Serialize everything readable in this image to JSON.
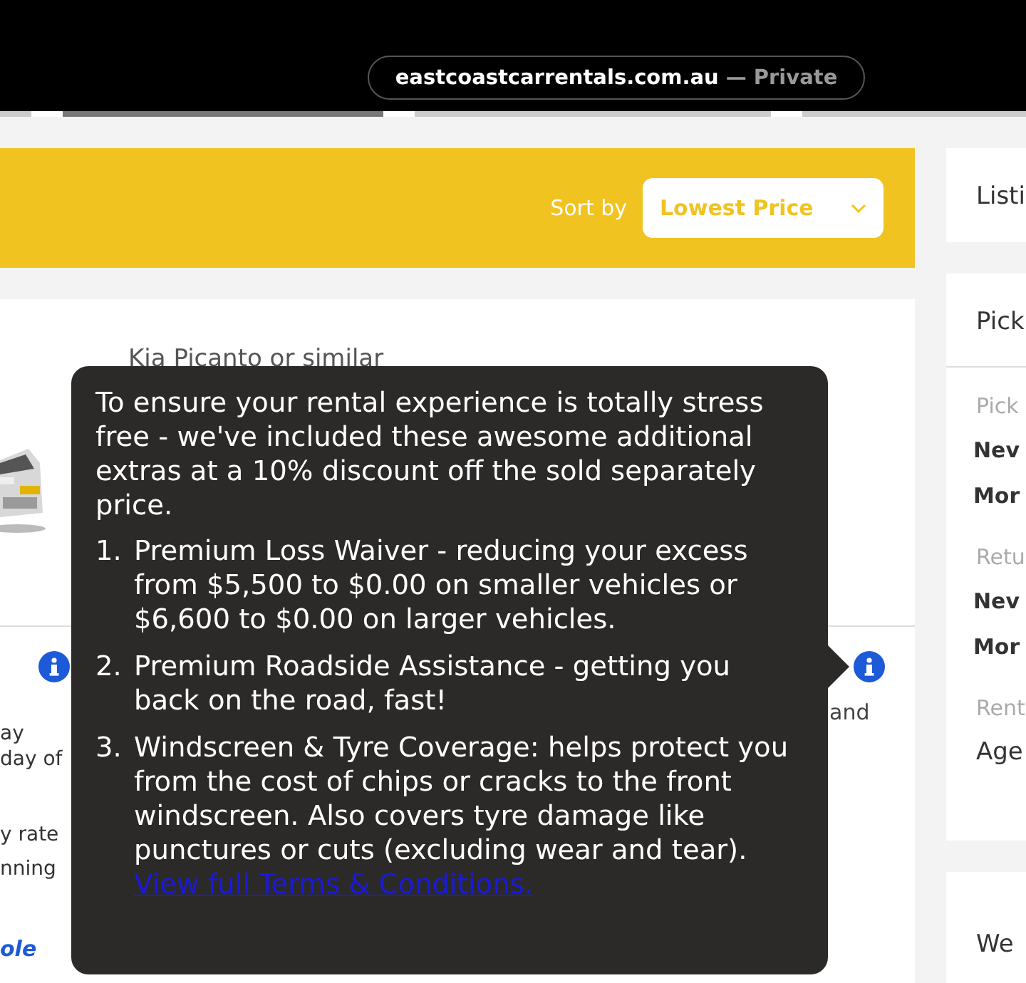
{
  "browser": {
    "url": "eastcoastcarrentals.com.au",
    "mode": "— Private"
  },
  "toolbar": {
    "sort_label": "Sort by",
    "sort_value": "Lowest Price"
  },
  "listing": {
    "vehicle": "Kia Picanto or similar",
    "fragments": [
      "ay",
      "day of",
      "y rate",
      "nning"
    ],
    "link": "ole",
    "right_text": "and"
  },
  "tooltip": {
    "intro": "To ensure your rental experience is totally stress free - we've included these awesome additional extras at a 10% discount off the sold separately price.",
    "items": [
      {
        "number": "1.",
        "text": "Premium Loss Waiver - reducing your excess from $5,500 to $0.00 on smaller vehicles or $6,600 to $0.00 on larger vehicles."
      },
      {
        "number": "2.",
        "text": "Premium Roadside Assistance - getting you back on the road, fast!"
      },
      {
        "number": "3.",
        "text": "Windscreen & Tyre Coverage: helps protect you from the cost of chips or cracks to the front windscreen. Also covers tyre damage like punctures or cuts (excluding wear and tear)."
      }
    ],
    "link": "View full Terms & Conditions."
  },
  "sidebar": {
    "card_title": "Listi",
    "summary_title": "Pick",
    "rows": [
      {
        "label": "Pick",
        "lines": [
          {
            "text": "Nev",
            "kind": "bold"
          },
          {
            "text": "Mor",
            "kind": "bold"
          }
        ]
      },
      {
        "label": "Retu",
        "lines": [
          {
            "text": "Nev",
            "kind": "bold"
          },
          {
            "text": "Mor",
            "kind": "bold"
          }
        ]
      },
      {
        "label": "Rent",
        "lines": [
          {
            "text": "Age",
            "kind": "plain"
          }
        ]
      }
    ],
    "note": "We"
  }
}
